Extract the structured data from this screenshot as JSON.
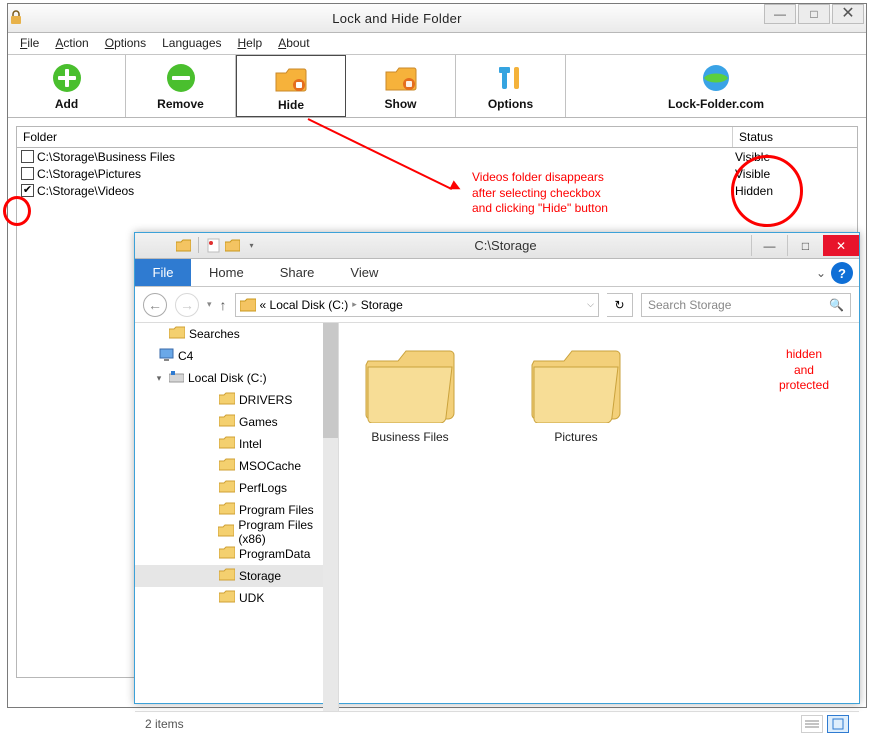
{
  "app": {
    "title": "Lock and Hide Folder",
    "window_buttons": {
      "min": "—",
      "max": "□",
      "close": "✕"
    }
  },
  "menu": {
    "file": "File",
    "action": "Action",
    "options": "Options",
    "languages": "Languages",
    "help": "Help",
    "about": "About"
  },
  "toolbar": {
    "add": {
      "label": "Add"
    },
    "remove": {
      "label": "Remove"
    },
    "hide": {
      "label": "Hide"
    },
    "show": {
      "label": "Show"
    },
    "options": {
      "label": "Options"
    },
    "site": {
      "label": "Lock-Folder.com"
    }
  },
  "list": {
    "col_folder": "Folder",
    "col_status": "Status",
    "rows": [
      {
        "checked": false,
        "path": "C:\\Storage\\Business Files",
        "status": "Visible"
      },
      {
        "checked": false,
        "path": "C:\\Storage\\Pictures",
        "status": "Visible"
      },
      {
        "checked": true,
        "path": "C:\\Storage\\Videos",
        "status": "Hidden"
      }
    ]
  },
  "annotations": {
    "main": "Videos folder disappears\nafter selecting checkbox\nand clicking \"Hide\" button",
    "content": "hidden\nand\nprotected"
  },
  "explorer": {
    "title": "C:\\Storage",
    "window_buttons": {
      "min": "—",
      "max": "□",
      "close": "✕"
    },
    "ribbon": {
      "file": "File",
      "home": "Home",
      "share": "Share",
      "view": "View",
      "help": "?"
    },
    "breadcrumb": {
      "pre": "«  Local Disk (C:)",
      "seg2": "Storage"
    },
    "search_placeholder": "Search Storage",
    "tree": {
      "top": [
        {
          "icon": "folder",
          "label": "Searches",
          "indent": "indent1"
        },
        {
          "icon": "pc",
          "label": "C4",
          "indent": "indent0"
        },
        {
          "icon": "drive",
          "label": "Local Disk (C:)",
          "indent": "indent1",
          "expander": "▾"
        }
      ],
      "folders": [
        "DRIVERS",
        "Games",
        "Intel",
        "MSOCache",
        "PerfLogs",
        "Program Files",
        "Program Files (x86)",
        "ProgramData",
        "Storage",
        "UDK"
      ],
      "selected": "Storage"
    },
    "content_items": [
      {
        "label": "Business Files"
      },
      {
        "label": "Pictures"
      }
    ],
    "status": {
      "text": "2 items"
    }
  }
}
